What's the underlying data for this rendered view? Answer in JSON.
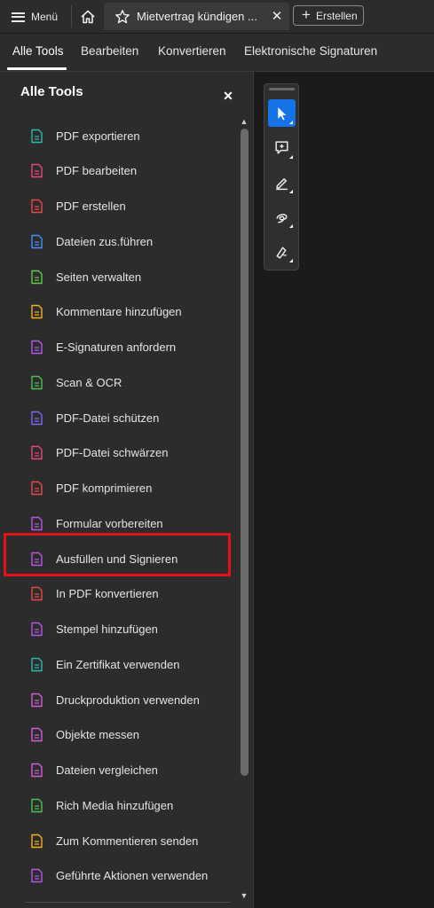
{
  "topbar": {
    "menu_label": "Menü",
    "tab_title": "Mietvertrag kündigen ...",
    "create_label": "Erstellen"
  },
  "nav": {
    "items": [
      "Alle Tools",
      "Bearbeiten",
      "Konvertieren",
      "Elektronische Signaturen"
    ],
    "active": "Alle Tools"
  },
  "panel": {
    "title": "Alle Tools",
    "tools": [
      {
        "label": "PDF exportieren",
        "icon": "export-pdf-icon",
        "color": "#2db7a8"
      },
      {
        "label": "PDF bearbeiten",
        "icon": "edit-pdf-icon",
        "color": "#e8467c"
      },
      {
        "label": "PDF erstellen",
        "icon": "create-pdf-icon",
        "color": "#e5484d"
      },
      {
        "label": "Dateien zus.führen",
        "icon": "combine-files-icon",
        "color": "#4c8dff"
      },
      {
        "label": "Seiten verwalten",
        "icon": "organize-pages-icon",
        "color": "#63c94a"
      },
      {
        "label": "Kommentare hinzufügen",
        "icon": "comment-icon",
        "color": "#f2b01e"
      },
      {
        "label": "E-Signaturen anfordern",
        "icon": "request-esign-icon",
        "color": "#b457e6"
      },
      {
        "label": "Scan & OCR",
        "icon": "scan-ocr-icon",
        "color": "#4bbf5a"
      },
      {
        "label": "PDF-Datei schützen",
        "icon": "protect-pdf-icon",
        "color": "#7b68ee"
      },
      {
        "label": "PDF-Datei schwärzen",
        "icon": "redact-pdf-icon",
        "color": "#e8467c"
      },
      {
        "label": "PDF komprimieren",
        "icon": "compress-pdf-icon",
        "color": "#e5484d"
      },
      {
        "label": "Formular vorbereiten",
        "icon": "prepare-form-icon",
        "color": "#b457e6"
      },
      {
        "label": "Ausfüllen und Signieren",
        "icon": "fill-sign-icon",
        "color": "#b457e6"
      },
      {
        "label": "In PDF konvertieren",
        "icon": "convert-to-pdf-icon",
        "color": "#e5484d"
      },
      {
        "label": "Stempel hinzufügen",
        "icon": "stamp-icon",
        "color": "#b457e6"
      },
      {
        "label": "Ein Zertifikat verwenden",
        "icon": "certificate-icon",
        "color": "#2db7a8"
      },
      {
        "label": "Druckproduktion verwenden",
        "icon": "print-production-icon",
        "color": "#d35bd8"
      },
      {
        "label": "Objekte messen",
        "icon": "measure-icon",
        "color": "#d35bd8"
      },
      {
        "label": "Dateien vergleichen",
        "icon": "compare-files-icon",
        "color": "#d35bd8"
      },
      {
        "label": "Rich Media hinzufügen",
        "icon": "rich-media-icon",
        "color": "#4bbf5a"
      },
      {
        "label": "Zum Kommentieren senden",
        "icon": "send-comment-icon",
        "color": "#f2b01e"
      },
      {
        "label": "Geführte Aktionen verwenden",
        "icon": "guided-actions-icon",
        "color": "#b457e6"
      }
    ]
  },
  "quick_tools": [
    {
      "icon": "select-cursor-icon",
      "selected": true
    },
    {
      "icon": "add-comment-icon",
      "selected": false
    },
    {
      "icon": "highlight-pen-icon",
      "selected": false
    },
    {
      "icon": "freehand-draw-icon",
      "selected": false
    },
    {
      "icon": "sign-pen-icon",
      "selected": false
    }
  ],
  "colors": {
    "accent": "#1473e6",
    "highlight_box": "#e3111b"
  }
}
